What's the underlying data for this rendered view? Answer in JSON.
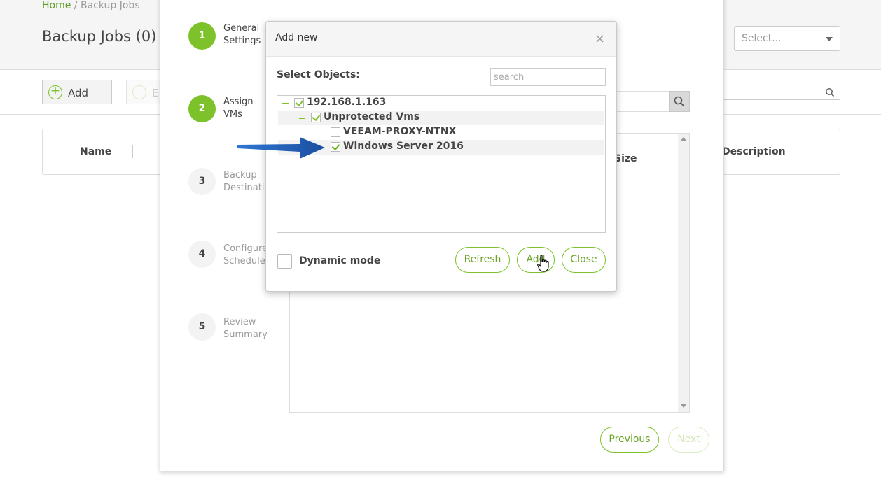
{
  "breadcrumb": {
    "home": "Home",
    "separator": " / ",
    "current": "Backup Jobs"
  },
  "page": {
    "title": "Backup Jobs (0)"
  },
  "top_select": {
    "value": "Select..."
  },
  "toolbar": {
    "add_label": "Add",
    "edit_label": "E"
  },
  "table": {
    "col_name": "Name",
    "col_description": "Description"
  },
  "wizard": {
    "steps": [
      {
        "number": "1",
        "label": "General\nSettings",
        "state": "done"
      },
      {
        "number": "2",
        "label": "Assign\nVMs",
        "state": "active"
      },
      {
        "number": "3",
        "label": "Backup\nDestination",
        "state": "pending"
      },
      {
        "number": "4",
        "label": "Configure\nSchedule",
        "state": "pending"
      },
      {
        "number": "5",
        "label": "Review\nSummary",
        "state": "pending"
      }
    ],
    "col_size": "Size",
    "previous_label": "Previous",
    "next_label": "Next"
  },
  "modal": {
    "title": "Add new",
    "close_glyph": "×",
    "select_objects_label": "Select Objects:",
    "search_placeholder": "search",
    "tree": [
      {
        "label": "192.168.1.163",
        "level": 0,
        "checked": true,
        "expanded": true
      },
      {
        "label": "Unprotected Vms",
        "level": 1,
        "checked": true,
        "expanded": true
      },
      {
        "label": "VEEAM-PROXY-NTNX",
        "level": 2,
        "checked": false
      },
      {
        "label": "Windows Server 2016",
        "level": 2,
        "checked": true
      }
    ],
    "dynamic_mode_label": "Dynamic mode",
    "dynamic_mode_checked": false,
    "refresh_label": "Refresh",
    "add_label": "Add",
    "close_label": "Close"
  },
  "colors": {
    "accent": "#7dc22a",
    "arrow": "#1f5fb5"
  }
}
